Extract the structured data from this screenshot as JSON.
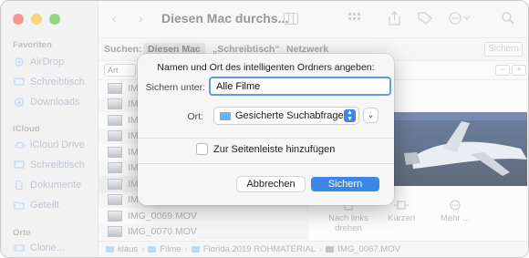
{
  "window": {
    "title": "Diesen Mac durchs...",
    "colors": {
      "close": "#f25e57",
      "minimize": "#f6bd3b",
      "zoom": "#57c23c",
      "accent": "#3c86e9"
    }
  },
  "sidebar": {
    "sections": [
      {
        "title": "Favoriten",
        "items": [
          {
            "label": "AirDrop",
            "icon": "airdrop-icon"
          },
          {
            "label": "Schreibtisch",
            "icon": "desktop-icon"
          },
          {
            "label": "Downloads",
            "icon": "downloads-icon"
          }
        ]
      },
      {
        "title": "iCloud",
        "items": [
          {
            "label": "iCloud Drive",
            "icon": "cloud-icon"
          },
          {
            "label": "Schreibtisch",
            "icon": "desktop-icon"
          },
          {
            "label": "Dokumente",
            "icon": "document-icon"
          },
          {
            "label": "Geteilt",
            "icon": "shared-folder-icon"
          }
        ]
      },
      {
        "title": "Orte",
        "items": [
          {
            "label": "Clone...",
            "icon": "disk-icon"
          }
        ]
      }
    ]
  },
  "searchbar": {
    "label": "Suchen:",
    "scopes": [
      "Diesen Mac",
      "„Schreibtisch“",
      "Netzwerk"
    ],
    "save": "Sichern"
  },
  "filter": {
    "attribute": "Art"
  },
  "files": [
    {
      "name": "IMG"
    },
    {
      "name": "IMG"
    },
    {
      "name": "IMG"
    },
    {
      "name": "IMG"
    },
    {
      "name": "IMG"
    },
    {
      "name": "IMG"
    },
    {
      "name": "IMG"
    },
    {
      "name": "IMG"
    },
    {
      "name": "IMG_0069.MOV"
    },
    {
      "name": "IMG_0070.MOV"
    }
  ],
  "quick_actions": [
    {
      "label": "Nach links drehen",
      "icon": "rotate-left-icon"
    },
    {
      "label": "Kürzen",
      "icon": "trim-icon"
    },
    {
      "label": "Mehr ...",
      "icon": "more-icon"
    }
  ],
  "pathbar": [
    "klaus",
    "Filme",
    "Florida 2019 ROHMATERIAL",
    "IMG_0067.MOV"
  ],
  "dialog": {
    "title": "Namen und Ort des intelligenten Ordners angeben:",
    "name_label": "Sichern unter:",
    "name_value": "Alle Filme",
    "where_label": "Ort:",
    "where_value": "Gesicherte Suchabfragen",
    "checkbox_label": "Zur Seitenleiste hinzufügen",
    "checkbox_checked": false,
    "cancel": "Abbrechen",
    "ok": "Sichern"
  }
}
